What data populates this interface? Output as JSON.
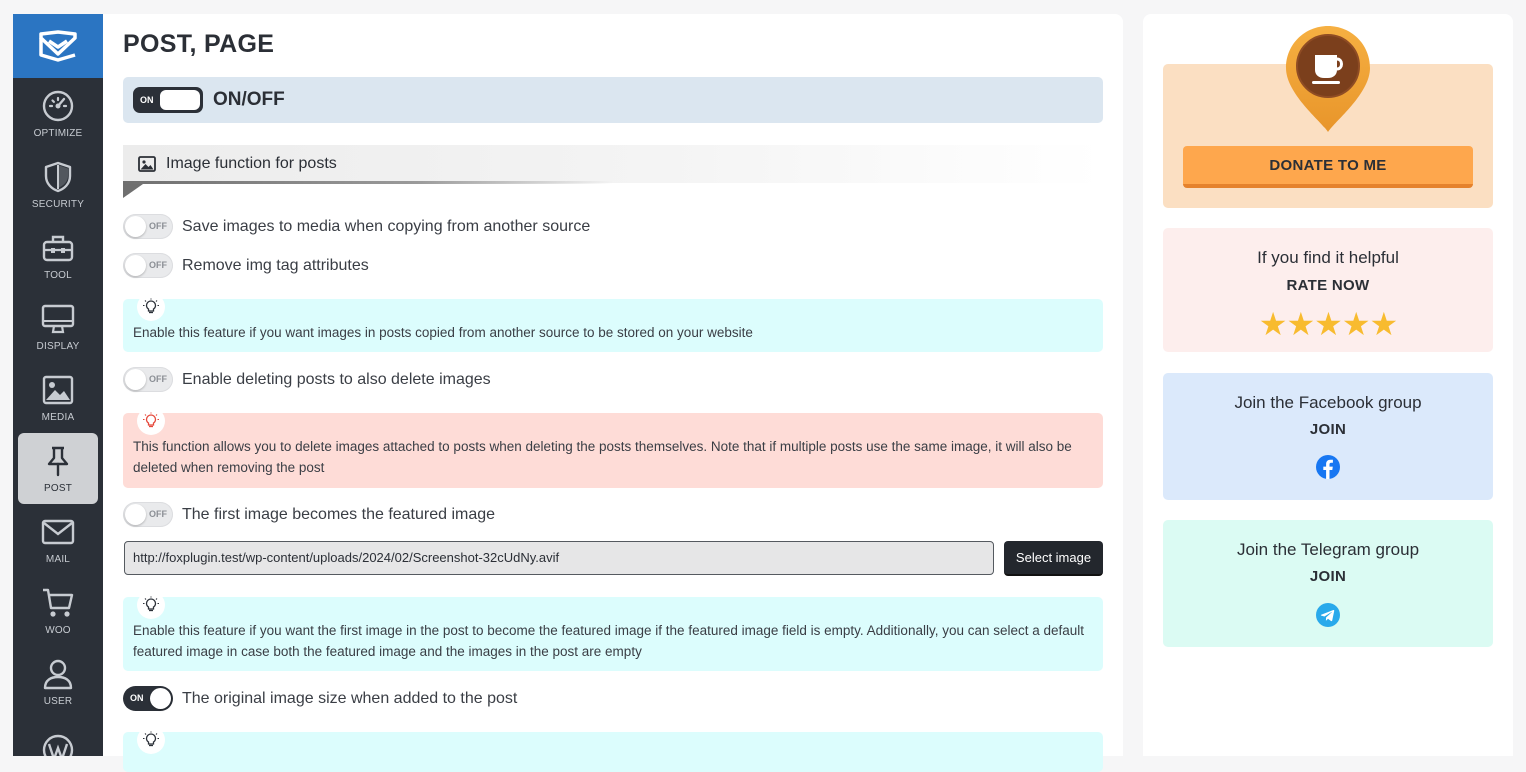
{
  "sidebar": {
    "items": [
      {
        "label": "OPTIMIZE",
        "icon": "speedometer-icon"
      },
      {
        "label": "SECURITY",
        "icon": "shield-icon"
      },
      {
        "label": "TOOL",
        "icon": "toolbox-icon"
      },
      {
        "label": "DISPLAY",
        "icon": "monitor-icon"
      },
      {
        "label": "MEDIA",
        "icon": "image-icon"
      },
      {
        "label": "POST",
        "icon": "pin-icon",
        "active": true
      },
      {
        "label": "MAIL",
        "icon": "mail-icon"
      },
      {
        "label": "WOO",
        "icon": "cart-icon"
      },
      {
        "label": "USER",
        "icon": "user-icon"
      }
    ]
  },
  "main": {
    "title": "POST, PAGE",
    "master_toggle": {
      "state_label": "ON",
      "label": "ON/OFF"
    },
    "section": {
      "title": "Image function for posts",
      "icon": "image-icon"
    },
    "options": {
      "save_images": {
        "state": "OFF",
        "label": "Save images to media when copying from another source"
      },
      "remove_attrs": {
        "state": "OFF",
        "label": "Remove img tag attributes"
      },
      "delete_images": {
        "state": "OFF",
        "label": "Enable deleting posts to also delete images"
      },
      "featured_image": {
        "state": "OFF",
        "label": "The first image becomes the featured image"
      },
      "original_size": {
        "state": "ON",
        "label": "The original image size when added to the post"
      }
    },
    "notes": {
      "save_images": "Enable this feature if you want images in posts copied from another source to be stored on your website",
      "delete_images": "This function allows you to delete images attached to posts when deleting the posts themselves. Note that if multiple posts use the same image, it will also be deleted when removing the post",
      "featured_image": "Enable this feature if you want the first image in the post to become the featured image if the featured image field is empty. Additionally, you can select a default featured image in case both the featured image and the images in the post are empty"
    },
    "featured_url": "http://foxplugin.test/wp-content/uploads/2024/02/Screenshot-32cUdNy.avif",
    "select_image_label": "Select image"
  },
  "right": {
    "donate": {
      "button": "DONATE TO ME",
      "icon": "coffee-cup-icon"
    },
    "rate": {
      "title": "If you find it helpful",
      "action": "RATE NOW",
      "stars": "★★★★★"
    },
    "facebook": {
      "title": "Join the Facebook group",
      "action": "JOIN",
      "icon": "facebook-icon"
    },
    "telegram": {
      "title": "Join the Telegram group",
      "action": "JOIN",
      "icon": "telegram-icon"
    }
  },
  "colors": {
    "sidebar_bg": "#2b3038",
    "logo_bg": "#2b75c2",
    "cyan_note": "#dcfdfd",
    "pink_note": "#fedcd7",
    "donate_btn": "#fea74d",
    "star": "#f8bb2f"
  }
}
